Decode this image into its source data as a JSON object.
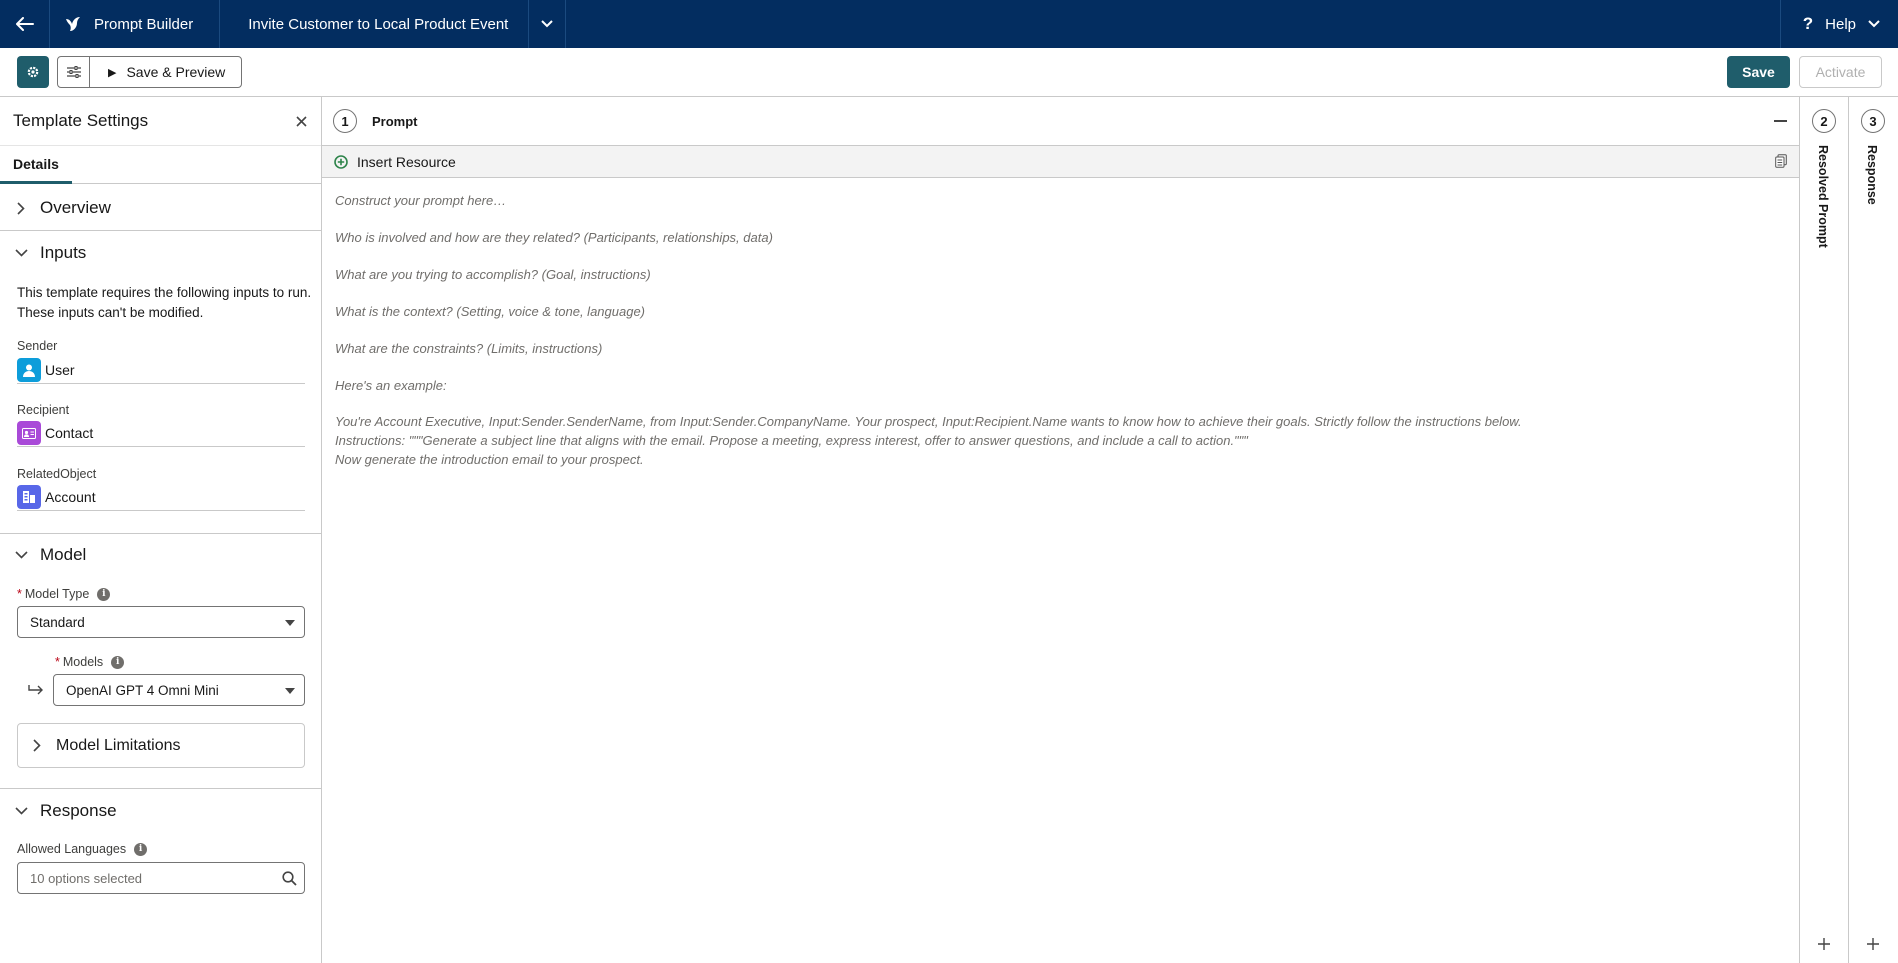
{
  "topbar": {
    "app_name": "Prompt Builder",
    "template_title": "Invite Customer to Local Product Event",
    "help_label": "Help"
  },
  "toolbar": {
    "save_preview_label": "Save & Preview",
    "save_label": "Save",
    "activate_label": "Activate"
  },
  "left_panel": {
    "title": "Template Settings",
    "tab_details": "Details",
    "overview_label": "Overview",
    "inputs": {
      "label": "Inputs",
      "description": "This template requires the following inputs to run. These inputs can't be modified.",
      "fields": [
        {
          "label": "Sender",
          "value": "User",
          "icon": "user-icon",
          "color": "#0d9dda"
        },
        {
          "label": "Recipient",
          "value": "Contact",
          "icon": "contact-icon",
          "color": "#a94ad8"
        },
        {
          "label": "RelatedObject",
          "value": "Account",
          "icon": "account-icon",
          "color": "#5867e8"
        }
      ]
    },
    "model": {
      "label": "Model",
      "model_type_label": "Model Type",
      "model_type_value": "Standard",
      "models_label": "Models",
      "models_value": "OpenAI GPT 4 Omni Mini",
      "limitations_label": "Model Limitations"
    },
    "response": {
      "label": "Response",
      "languages_label": "Allowed Languages",
      "languages_value": "10 options selected"
    }
  },
  "prompt_panel": {
    "step": "1",
    "title": "Prompt",
    "insert_resource_label": "Insert Resource",
    "placeholder_lines": [
      "Construct your prompt here…",
      "Who is involved and how are they related? (Participants, relationships, data)",
      "What are you trying to accomplish? (Goal, instructions)",
      "What is the context? (Setting, voice & tone, language)",
      "What are the constraints? (Limits, instructions)",
      "Here's an example:",
      "You're Account Executive, Input:Sender.SenderName, from Input:Sender.CompanyName. Your prospect, Input:Recipient.Name wants to know how to achieve their goals. Strictly follow the instructions below.",
      "Instructions: \"\"\"Generate a subject line that aligns with the email. Propose a meeting, express interest, offer to answer questions, and include a call to action.\"\"\"",
      "Now generate the introduction email to your prospect."
    ]
  },
  "resolved_panel": {
    "step": "2",
    "title": "Resolved Prompt"
  },
  "response_panel": {
    "step": "3",
    "title": "Response"
  },
  "colors": {
    "nav": "#032d60",
    "brand_button": "#1f5d6b"
  }
}
